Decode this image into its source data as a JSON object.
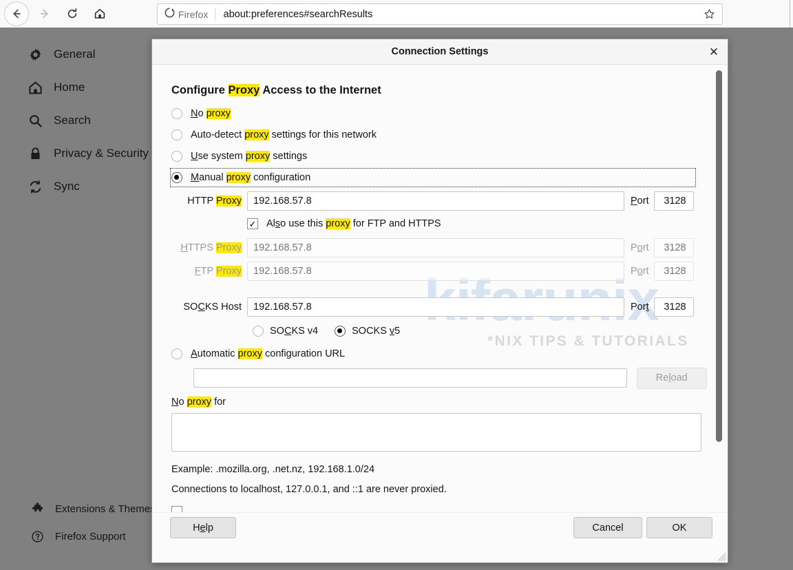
{
  "browser": {
    "nav": {
      "back_icon": "arrow-left-icon",
      "forward_icon": "arrow-right-icon",
      "reload_icon": "reload-icon",
      "home_icon": "home-icon"
    },
    "urlbar": {
      "brand_label": "Firefox",
      "brand_icon": "firefox-logo-icon",
      "url": "about:preferences#searchResults",
      "bookmark_icon": "star-icon"
    }
  },
  "sidebar": {
    "items": [
      {
        "icon": "gear-icon",
        "label": "General"
      },
      {
        "icon": "home-icon",
        "label": "Home"
      },
      {
        "icon": "search-icon",
        "label": "Search"
      },
      {
        "icon": "lock-icon",
        "label": "Privacy & Security"
      },
      {
        "icon": "sync-icon",
        "label": "Sync"
      }
    ],
    "bottom_items": [
      {
        "icon": "puzzle-icon",
        "label": "Extensions & Themes"
      },
      {
        "icon": "question-circle-icon",
        "label": "Firefox Support"
      }
    ]
  },
  "watermark": {
    "main": "kifarunix",
    "sub": "*NIX TIPS & TUTORIALS"
  },
  "dialog": {
    "title": "Connection Settings",
    "close_icon": "close-icon",
    "heading": {
      "part1": "Configure ",
      "highlight": "Proxy",
      "part2": " Access to the Internet"
    },
    "proxy_modes": [
      {
        "id": "no-proxy",
        "selected": false,
        "accesskey": "N",
        "pre": "o ",
        "highlight": "proxy",
        "post": ""
      },
      {
        "id": "auto-detect",
        "selected": false,
        "accesskey": "A",
        "pre": "uto-detect ",
        "highlight": "proxy",
        "post": " settings for this network"
      },
      {
        "id": "use-system",
        "selected": false,
        "accesskey": "U",
        "pre": "se system ",
        "highlight": "proxy",
        "post": " settings"
      },
      {
        "id": "manual",
        "selected": true,
        "accesskey": "M",
        "pre": "anual ",
        "highlight": "proxy",
        "post": " configuration"
      }
    ],
    "http": {
      "label_pre": "HTTP ",
      "label_highlight": "Proxy",
      "value": "192.168.57.8",
      "port_label": "Port",
      "port_accesskey": "P",
      "port_value": "3128"
    },
    "share_checkbox": {
      "checked": true,
      "check_glyph": "✓",
      "pre": "Al",
      "accesskey": "s",
      "mid": "o use this ",
      "highlight": "proxy",
      "post": " for FTP and HTTPS"
    },
    "https": {
      "label_accesskey": "H",
      "label_pre": "TTPS ",
      "label_highlight": "Proxy",
      "placeholder": "192.168.57.8",
      "port_label": "Port",
      "port_value": "3128",
      "disabled": true
    },
    "ftp": {
      "label_accesskey": "F",
      "label_pre": "TP ",
      "label_highlight": "Proxy",
      "placeholder": "192.168.57.8",
      "port_label": "Port",
      "port_value": "3128",
      "disabled": true
    },
    "socks": {
      "label_pre": "SO",
      "label_accesskey": "C",
      "label_post": "KS Host",
      "value": "192.168.57.8",
      "port_label": "Port",
      "port_value": "3128",
      "v4_label_pre": "SO",
      "v4_accesskey": "C",
      "v4_label_post": "KS v4",
      "v4_selected": false,
      "v5_label_pre": "SOCKS ",
      "v5_accesskey": "v",
      "v5_label_post": "5",
      "v5_selected": true
    },
    "pac": {
      "selected": false,
      "accesskey": "A",
      "label_pre": "utomatic ",
      "highlight": "proxy",
      "label_post": " configuration URL",
      "url_value": "",
      "reload_pre": "Re",
      "reload_accesskey": "l",
      "reload_post": "oad",
      "reload_disabled": true
    },
    "no_proxy_for": {
      "accesskey": "N",
      "pre": "o ",
      "highlight": "proxy",
      "post": " for",
      "value": ""
    },
    "example_note": "Example: .mozilla.org, .net.nz, 192.168.1.0/24",
    "localhost_note": "Connections to localhost, 127.0.0.1, and ::1 are never proxied.",
    "footer": {
      "help_pre": "H",
      "help_accesskey": "e",
      "help_post": "lp",
      "cancel_label": "Cancel",
      "ok_label": "OK"
    }
  }
}
